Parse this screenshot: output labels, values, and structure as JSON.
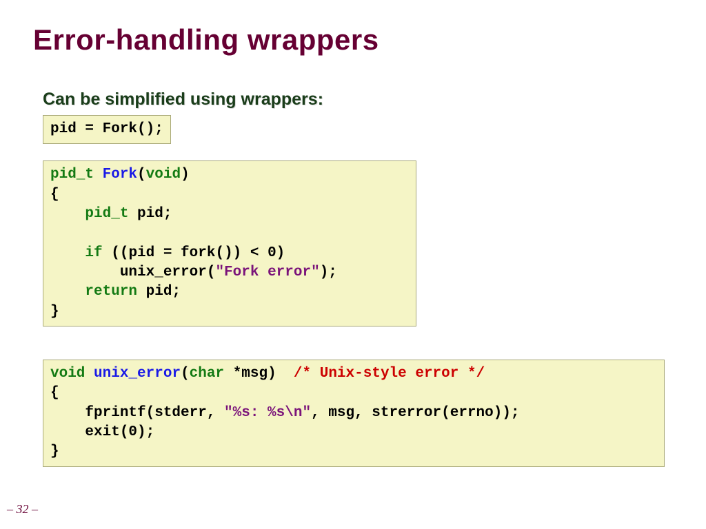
{
  "title": "Error-handling wrappers",
  "subtitle": "Can be simplified using wrappers:",
  "page_num": "– 32 –",
  "code": {
    "call": {
      "t1": "pid = Fork();"
    },
    "fork": {
      "l1a": "pid_t",
      "l1b": "Fork",
      "l1c": "(",
      "l1d": "void",
      "l1e": ")",
      "l2": "{",
      "l3a": "    ",
      "l3b": "pid_t",
      "l3c": " pid;",
      "blank": "",
      "l4a": "    ",
      "l4b": "if",
      "l4c": " ((pid = fork()) < 0)",
      "l5a": "        unix_error(",
      "l5b": "\"Fork error\"",
      "l5c": ");",
      "l6a": "    ",
      "l6b": "return",
      "l6c": " pid;",
      "l7": "}"
    },
    "err": {
      "l1a": "void",
      "l1b": "unix_error",
      "l1c": "(",
      "l1d": "char",
      "l1e": " *msg)  ",
      "l1f": "/* Unix-style error */",
      "l2": "{",
      "l3a": "    fprintf(stderr, ",
      "l3b": "\"%s: %s\\n\"",
      "l3c": ", msg, strerror(errno));",
      "l4": "    exit(0);",
      "l5": "}"
    }
  }
}
